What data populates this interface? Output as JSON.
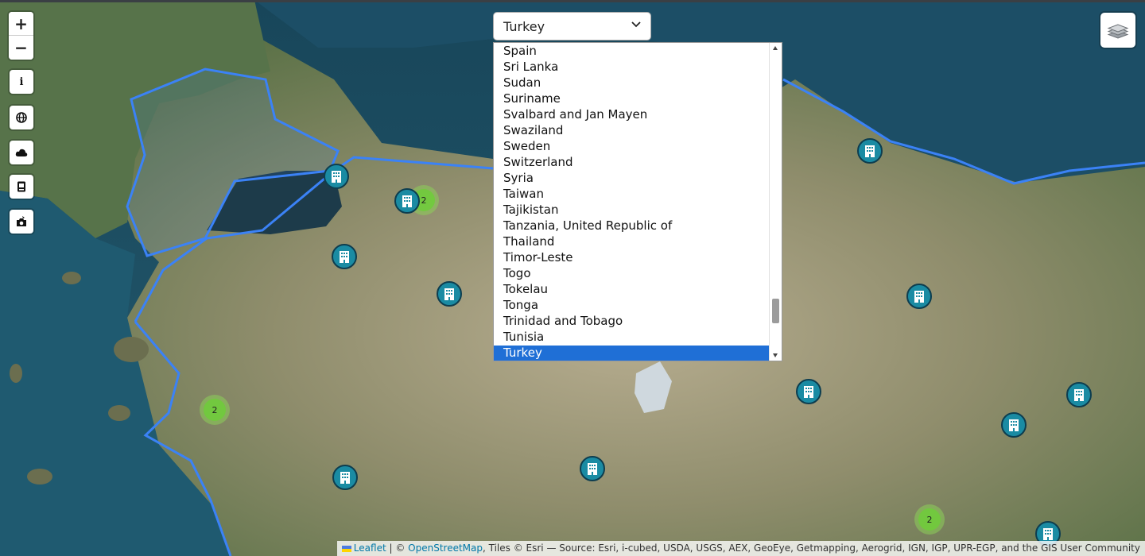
{
  "controls": {
    "zoom_in_label": "+",
    "zoom_out_label": "−",
    "side_icons": [
      "info-icon",
      "globe-icon",
      "cloud-icon",
      "book-icon",
      "camera-icon"
    ],
    "info_glyph": "i",
    "layers_icon": "layers-icon"
  },
  "country_select": {
    "selected": "Turkey",
    "options_visible": [
      "Spain",
      "Sri Lanka",
      "Sudan",
      "Suriname",
      "Svalbard and Jan Mayen",
      "Swaziland",
      "Sweden",
      "Switzerland",
      "Syria",
      "Taiwan",
      "Tajikistan",
      "Tanzania, United Republic of",
      "Thailand",
      "Timor-Leste",
      "Togo",
      "Tokelau",
      "Tonga",
      "Trinidad and Tobago",
      "Tunisia",
      "Turkey"
    ],
    "highlighted": "Turkey"
  },
  "clusters": [
    "2",
    "2",
    "2"
  ],
  "marker_icon": "building-icon",
  "attribution": {
    "leaflet": "Leaflet",
    "sep": " | © ",
    "osm": "OpenStreetMap",
    "tiles": ", Tiles © Esri — Source: Esri, i-cubed, USDA, USGS, AEX, GeoEye, Getmapping, Aerogrid, IGN, IGP, UPR-EGP, and the GIS User Community"
  },
  "colors": {
    "boundary": "#3b82f6",
    "marker_fill": "#1a8ba3",
    "cluster": "#6ecc39",
    "highlight": "#1f6fd6"
  }
}
